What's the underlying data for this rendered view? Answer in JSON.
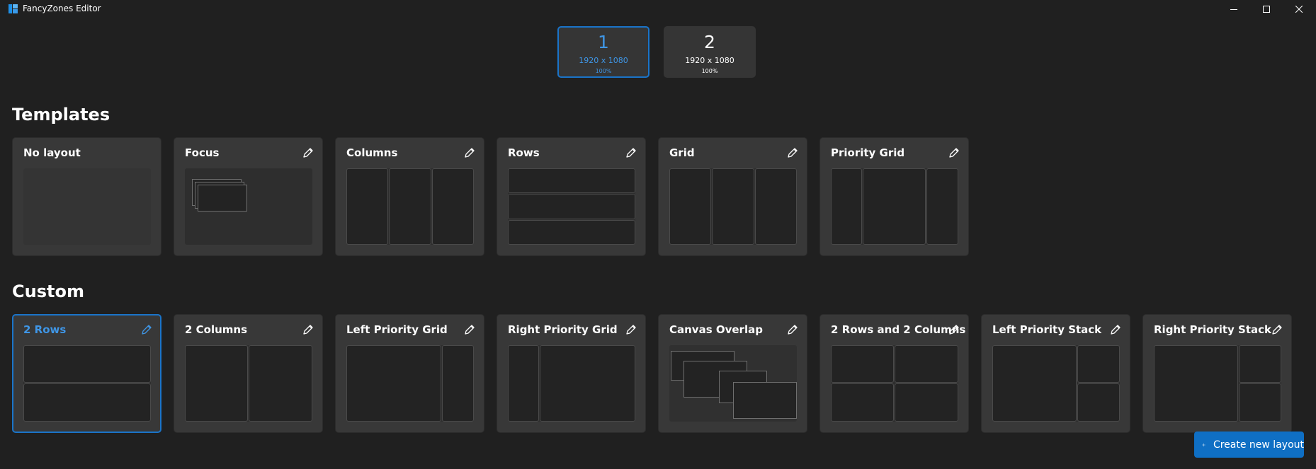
{
  "window": {
    "title": "FancyZones Editor",
    "controls": [
      "minimize-icon",
      "maximize-icon",
      "close-icon"
    ]
  },
  "monitors": [
    {
      "number": "1",
      "resolution": "1920 x 1080",
      "scale": "100%",
      "selected": true
    },
    {
      "number": "2",
      "resolution": "1920 x 1080",
      "scale": "100%",
      "selected": false
    }
  ],
  "templates": {
    "heading": "Templates",
    "items": [
      {
        "label": "No layout",
        "editable": false
      },
      {
        "label": "Focus",
        "editable": true
      },
      {
        "label": "Columns",
        "editable": true
      },
      {
        "label": "Rows",
        "editable": true
      },
      {
        "label": "Grid",
        "editable": true
      },
      {
        "label": "Priority Grid",
        "editable": true
      }
    ]
  },
  "custom": {
    "heading": "Custom",
    "items": [
      {
        "label": "2 Rows",
        "selected": true
      },
      {
        "label": "2 Columns",
        "selected": false
      },
      {
        "label": "Left Priority Grid",
        "selected": false
      },
      {
        "label": "Right Priority Grid",
        "selected": false
      },
      {
        "label": "Canvas Overlap",
        "selected": false
      },
      {
        "label": "2 Rows and 2 Columns",
        "selected": false
      },
      {
        "label": "Left Priority Stack",
        "selected": false
      },
      {
        "label": "Right Priority Stack",
        "selected": false
      }
    ]
  },
  "actions": {
    "create_layout_label": "Create new layout",
    "create_layout_icon": "plus-icon"
  },
  "colors": {
    "accent": "#1a74c9",
    "background": "#202020",
    "card": "#383838",
    "button": "#0f6fc4"
  }
}
